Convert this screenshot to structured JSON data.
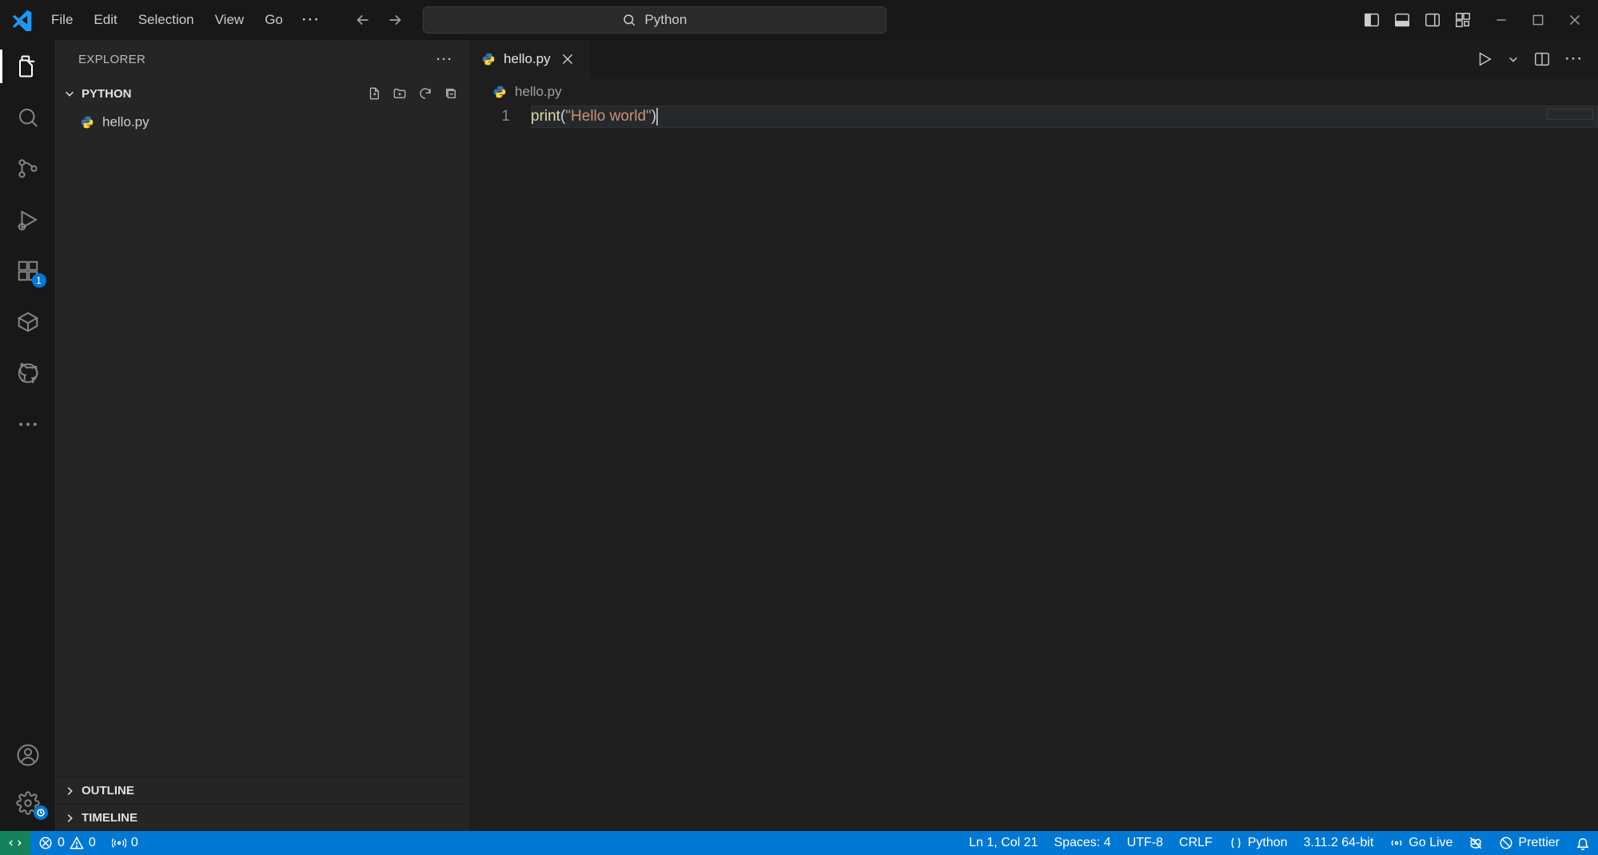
{
  "menu": {
    "file": "File",
    "edit": "Edit",
    "selection": "Selection",
    "view": "View",
    "go": "Go",
    "more": "···"
  },
  "titlebar": {
    "search_placeholder": "Python"
  },
  "activitybar": {
    "extensions_badge": "1"
  },
  "sidebar": {
    "title": "EXPLORER",
    "folder": "PYTHON",
    "files": [
      {
        "name": "hello.py",
        "icon": "python"
      }
    ],
    "outline": "OUTLINE",
    "timeline": "TIMELINE"
  },
  "editor": {
    "tab_label": "hello.py",
    "breadcrumb": "hello.py",
    "lines": [
      {
        "n": "1",
        "segments": [
          {
            "cls": "fn",
            "t": "print"
          },
          {
            "cls": "pn",
            "t": "("
          },
          {
            "cls": "str",
            "t": "\"Hello world\""
          },
          {
            "cls": "pn",
            "t": ")"
          }
        ]
      }
    ]
  },
  "status": {
    "errors": "0",
    "warnings": "0",
    "ports": "0",
    "cursor": "Ln 1, Col 21",
    "indent": "Spaces: 4",
    "encoding": "UTF-8",
    "eol": "CRLF",
    "lang": "Python",
    "interpreter": "3.11.2 64-bit",
    "golive": "Go Live",
    "prettier": "Prettier"
  }
}
